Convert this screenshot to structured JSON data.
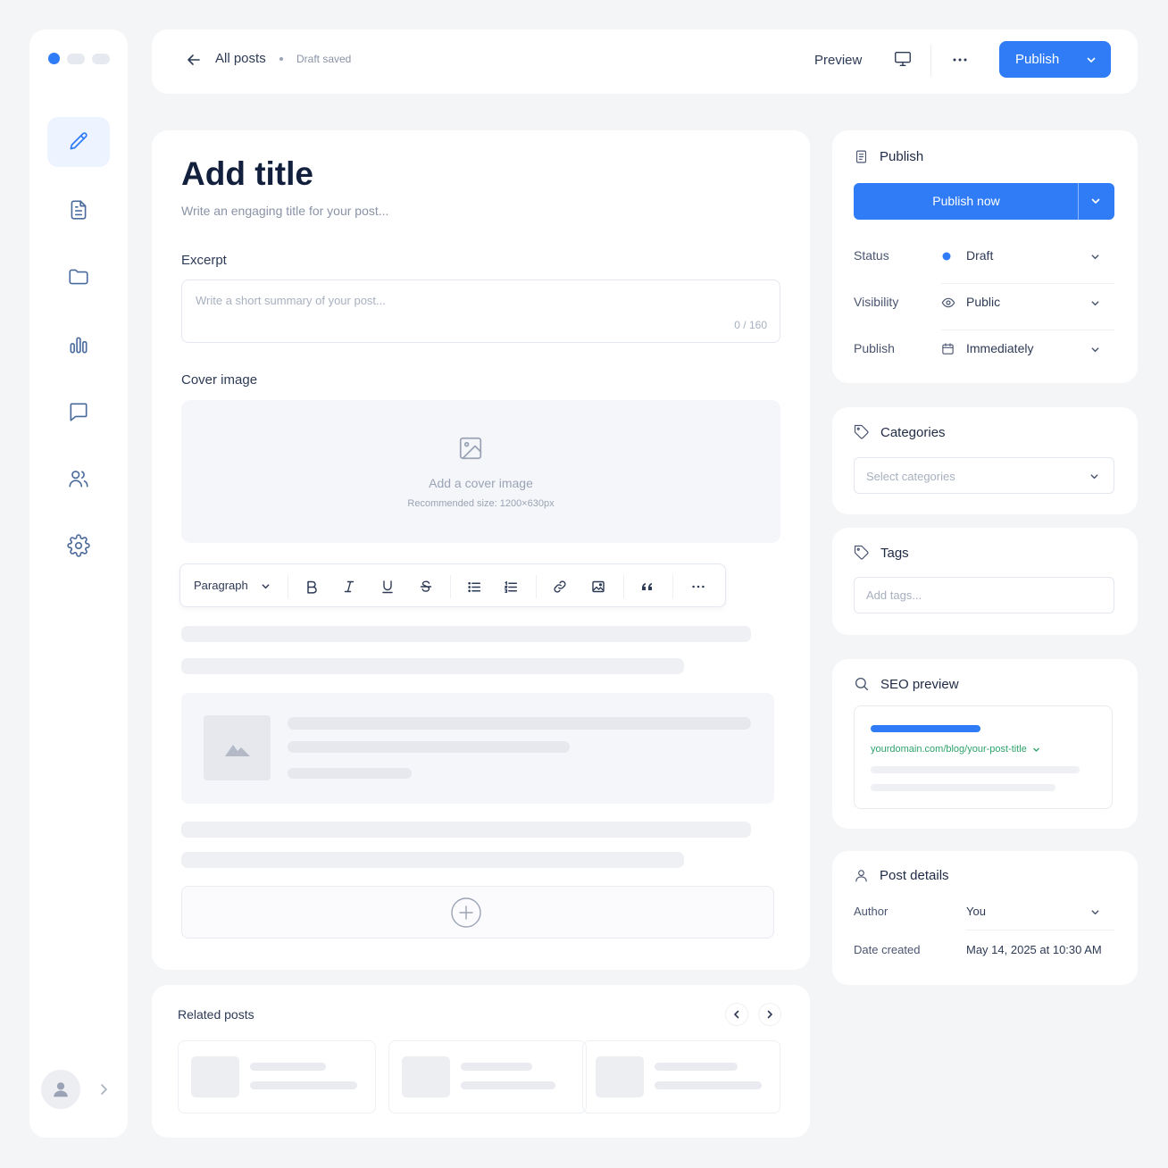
{
  "colors": {
    "accent": "#2f7cf6",
    "seo_url": "#2fa36b",
    "background": "#f4f5f7"
  },
  "sidebar": {
    "items": [
      {
        "icon": "pencil-icon",
        "active": true
      },
      {
        "icon": "document-icon"
      },
      {
        "icon": "folder-icon"
      },
      {
        "icon": "bar-chart-icon"
      },
      {
        "icon": "chat-icon"
      },
      {
        "icon": "users-icon"
      },
      {
        "icon": "gear-icon"
      }
    ]
  },
  "topbar": {
    "back_label": "All posts",
    "status": "Draft saved",
    "preview_label": "Preview",
    "publish_label": "Publish"
  },
  "editor": {
    "title": "Add title",
    "subtitle": "Write an engaging title for your post...",
    "excerpt_label": "Excerpt",
    "excerpt_placeholder": "Write a short summary of your post...",
    "excerpt_count": "0 / 160",
    "cover_label": "Cover image",
    "cover_cta": "Add a cover image",
    "cover_hint": "Recommended size: 1200×630px",
    "block_type": "Paragraph"
  },
  "related": {
    "title": "Related posts"
  },
  "publish_panel": {
    "title": "Publish",
    "publish_now_label": "Publish now",
    "rows": [
      {
        "label": "Status",
        "value": "Draft"
      },
      {
        "label": "Visibility",
        "value": "Public"
      },
      {
        "label": "Publish",
        "value": "Immediately"
      }
    ]
  },
  "categories": {
    "title": "Categories",
    "placeholder": "Select categories"
  },
  "tags": {
    "title": "Tags",
    "placeholder": "Add tags..."
  },
  "seo": {
    "title": "SEO preview",
    "url": "yourdomain.com/blog/your-post-title"
  },
  "details": {
    "title": "Post details",
    "author_label": "Author",
    "author_value": "You",
    "date_label": "Date created",
    "date_value": "May 14, 2025 at 10:30 AM"
  }
}
